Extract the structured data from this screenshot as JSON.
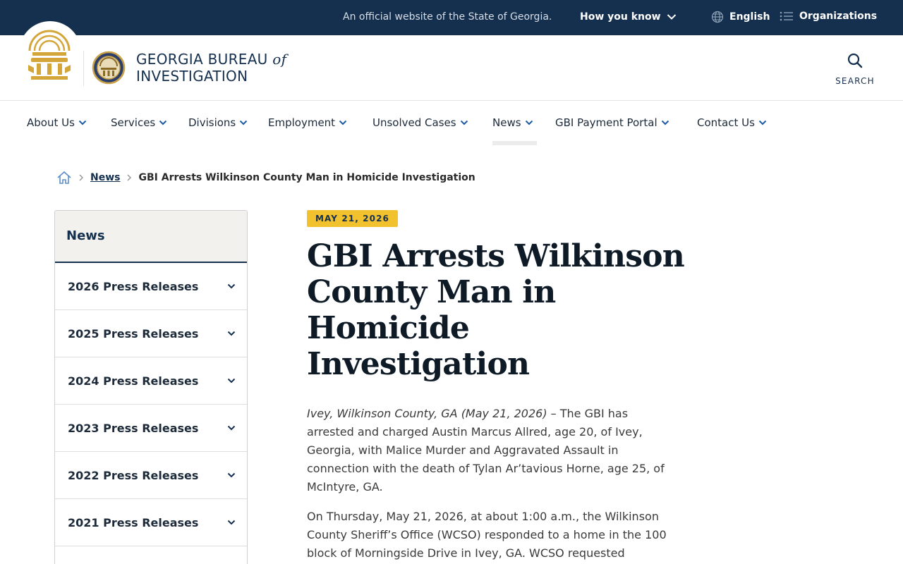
{
  "topbar": {
    "official_text": "An official website of the State of Georgia.",
    "how_you_know": "How you know",
    "language": "English",
    "organizations": "Organizations"
  },
  "header": {
    "brand_line1": "GEORGIA BUREAU",
    "brand_of": "of",
    "brand_line2": "INVESTIGATION",
    "search_label": "SEARCH"
  },
  "nav": {
    "items": [
      {
        "label": "About Us"
      },
      {
        "label": "Services"
      },
      {
        "label": "Divisions"
      },
      {
        "label": "Employment"
      },
      {
        "label": "Unsolved Cases"
      },
      {
        "label": "News"
      },
      {
        "label": "GBI Payment Portal"
      },
      {
        "label": "Contact Us"
      }
    ],
    "active": "News"
  },
  "breadcrumb": {
    "parent": "News",
    "current": "GBI Arrests Wilkinson County Man in Homicide Investigation"
  },
  "sidebar": {
    "title": "News",
    "items": [
      {
        "label": "2026 Press Releases"
      },
      {
        "label": "2025 Press Releases"
      },
      {
        "label": "2024 Press Releases"
      },
      {
        "label": "2023 Press Releases"
      },
      {
        "label": "2022 Press Releases"
      },
      {
        "label": "2021 Press Releases"
      }
    ]
  },
  "article": {
    "date": "MAY 21, 2026",
    "title": "GBI Arrests Wilkinson County Man in Homicide Investigation",
    "dateline": "Ivey, Wilkinson County, GA (May 21, 2026)",
    "para1_rest": " – The GBI has arrested and charged Austin Marcus Allred, age 20, of Ivey, Georgia, with Malice Murder and Aggravated Assault in connection with the death of Tylan Ar’tavious Horne, age 25, of McIntyre, GA.",
    "para2": "On Thursday, May 21, 2026, at about 1:00 a.m., the Wilkinson County Sheriff’s Office (WCSO) responded to a home in the 100 block of Morningside Drive in Ivey, GA. WCSO requested"
  },
  "colors": {
    "navy": "#15304f",
    "gold": "#f2c12e",
    "sidebar_head_bg": "#f2f1ee"
  }
}
